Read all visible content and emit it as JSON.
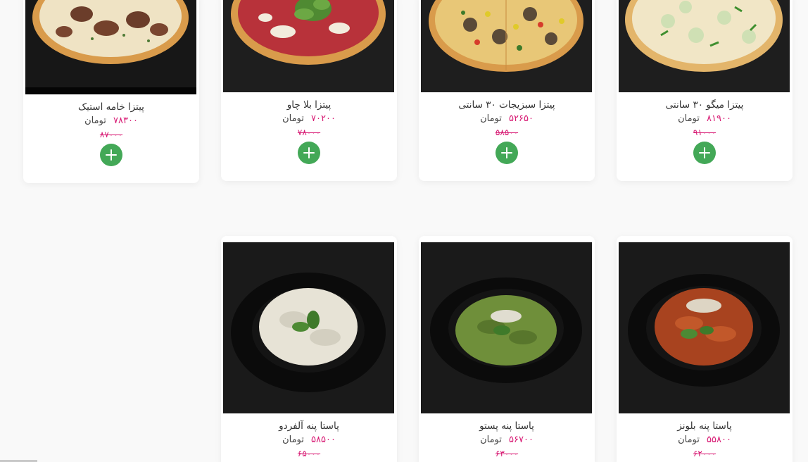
{
  "currency_label": "تومان",
  "products": [
    {
      "name": "پیتزا میگو ۳۰ سانتی",
      "price": "۸۱۹۰۰",
      "old_price": "۹۱۰۰۰",
      "image": "shrimp-pizza-photo"
    },
    {
      "name": "پیتزا سبزیجات ۳۰ سانتی",
      "price": "۵۲۶۵۰",
      "old_price": "۵۸۵۰۰",
      "image": "vegetable-pizza-photo"
    },
    {
      "name": "پیتزا بلا چاو",
      "price": "۷۰۲۰۰",
      "old_price": "۷۸۰۰۰",
      "image": "bella-ciao-pizza-photo"
    },
    {
      "name": "پیتزا خامه استیک",
      "price": "۷۸۳۰۰",
      "old_price": "۸۷۰۰۰",
      "image": "steak-cream-pizza-photo"
    },
    {
      "name": "پاستا پنه بلونز",
      "price": "۵۵۸۰۰",
      "old_price": "۶۲۰۰۰",
      "image": "penne-bolognese-photo"
    },
    {
      "name": "پاستا پنه پستو",
      "price": "۵۶۷۰۰",
      "old_price": "۶۳۰۰۰",
      "image": "penne-pesto-photo"
    },
    {
      "name": "پاستا پنه آلفردو",
      "price": "۵۸۵۰۰",
      "old_price": "۶۵۰۰۰",
      "image": "penne-alfredo-photo"
    }
  ],
  "colors": {
    "price": "#d81b74",
    "add_button": "#43a857",
    "photo_background": "#1c1c1c"
  }
}
